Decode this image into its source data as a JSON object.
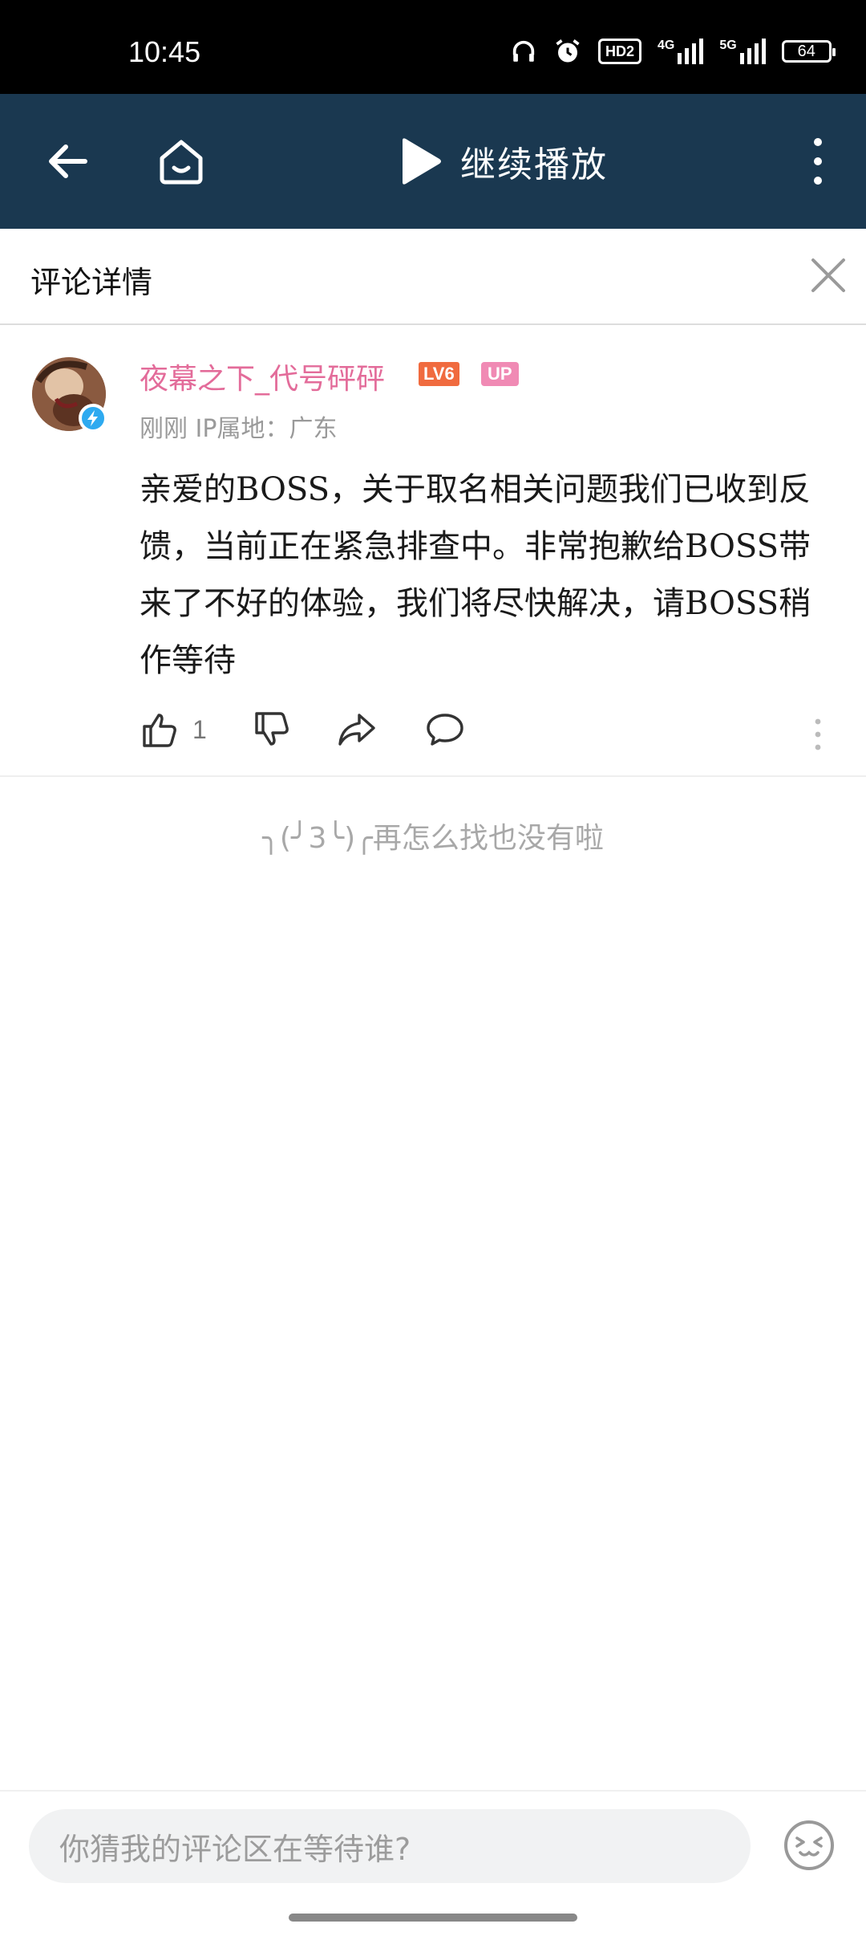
{
  "status_bar": {
    "time": "10:45",
    "hd": "HD2",
    "net1": "4G",
    "net2": "5G",
    "battery": "64"
  },
  "app_bar": {
    "resume_label": "继续播放"
  },
  "panel": {
    "title": "评论详情"
  },
  "comment": {
    "username": "夜幕之下_代号砰砰",
    "level_badge": "LV6",
    "up_badge": "UP",
    "meta": "刚刚 IP属地：广东",
    "text": "亲爱的BOSS，关于取名相关问题我们已收到反馈，当前正在紧急排查中。非常抱歉给BOSS带来了不好的体验，我们将尽快解决，请BOSS稍作等待",
    "like_count": "1"
  },
  "end_message": "╮(╯3╰)╭再怎么找也没有啦",
  "input": {
    "placeholder": "你猜我的评论区在等待谁?"
  }
}
